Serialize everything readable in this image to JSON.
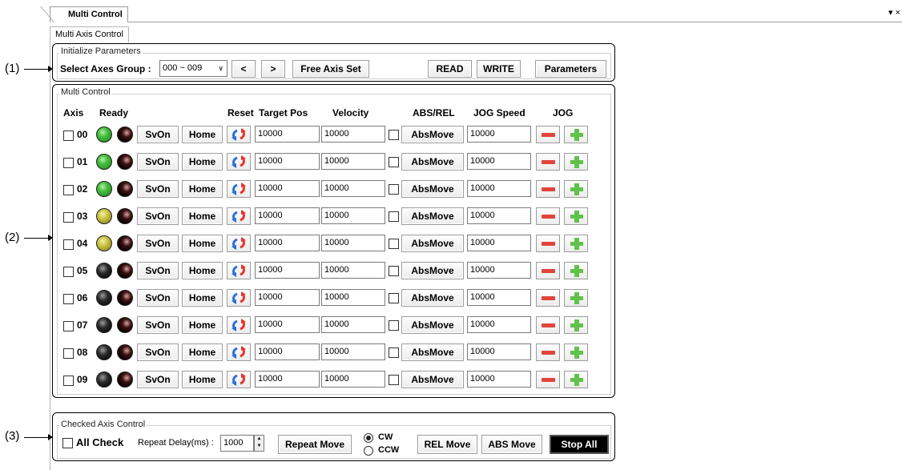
{
  "window": {
    "doc_tab": "Multi Control",
    "sub_tab": "Multi Axis Control",
    "controls": "▾ ×"
  },
  "callouts": [
    "(1)",
    "(2)",
    "(3)"
  ],
  "init_params": {
    "legend": "Initialize Parameters",
    "group_label": "Select Axes Group :",
    "group_value": "000 ~ 009",
    "prev_label": "<",
    "next_label": ">",
    "free_axis_label": "Free Axis Set",
    "read_label": "READ",
    "write_label": "WRITE",
    "parameters_label": "Parameters"
  },
  "multi_control": {
    "legend": "Multi Control",
    "headers": {
      "axis": "Axis",
      "ready": "Ready",
      "reset": "Reset",
      "target_pos": "Target Pos",
      "velocity": "Velocity",
      "abs_rel": "ABS/REL",
      "jog_speed": "JOG Speed",
      "jog": "JOG"
    },
    "svon_label": "SvOn",
    "home_label": "Home",
    "absmove_label": "AbsMove",
    "rows": [
      {
        "axis": "00",
        "ready_led": "green",
        "state_led": "red",
        "target": "10000",
        "velocity": "10000",
        "jog_speed": "10000"
      },
      {
        "axis": "01",
        "ready_led": "green",
        "state_led": "red",
        "target": "10000",
        "velocity": "10000",
        "jog_speed": "10000"
      },
      {
        "axis": "02",
        "ready_led": "green",
        "state_led": "red",
        "target": "10000",
        "velocity": "10000",
        "jog_speed": "10000"
      },
      {
        "axis": "03",
        "ready_led": "yellow",
        "state_led": "red",
        "target": "10000",
        "velocity": "10000",
        "jog_speed": "10000"
      },
      {
        "axis": "04",
        "ready_led": "yellow",
        "state_led": "red",
        "target": "10000",
        "velocity": "10000",
        "jog_speed": "10000"
      },
      {
        "axis": "05",
        "ready_led": "black",
        "state_led": "red",
        "target": "10000",
        "velocity": "10000",
        "jog_speed": "10000"
      },
      {
        "axis": "06",
        "ready_led": "black",
        "state_led": "red",
        "target": "10000",
        "velocity": "10000",
        "jog_speed": "10000"
      },
      {
        "axis": "07",
        "ready_led": "black",
        "state_led": "red",
        "target": "10000",
        "velocity": "10000",
        "jog_speed": "10000"
      },
      {
        "axis": "08",
        "ready_led": "black",
        "state_led": "red",
        "target": "10000",
        "velocity": "10000",
        "jog_speed": "10000"
      },
      {
        "axis": "09",
        "ready_led": "black",
        "state_led": "red",
        "target": "10000",
        "velocity": "10000",
        "jog_speed": "10000"
      }
    ]
  },
  "checked_control": {
    "legend": "Checked Axis Control",
    "all_check_label": "All Check",
    "repeat_delay_label": "Repeat Delay(ms) :",
    "repeat_delay_value": "1000",
    "repeat_move_label": "Repeat Move",
    "cw_label": "CW",
    "ccw_label": "CCW",
    "rel_move_label": "REL Move",
    "abs_move_label": "ABS Move",
    "stop_all_label": "Stop All"
  }
}
